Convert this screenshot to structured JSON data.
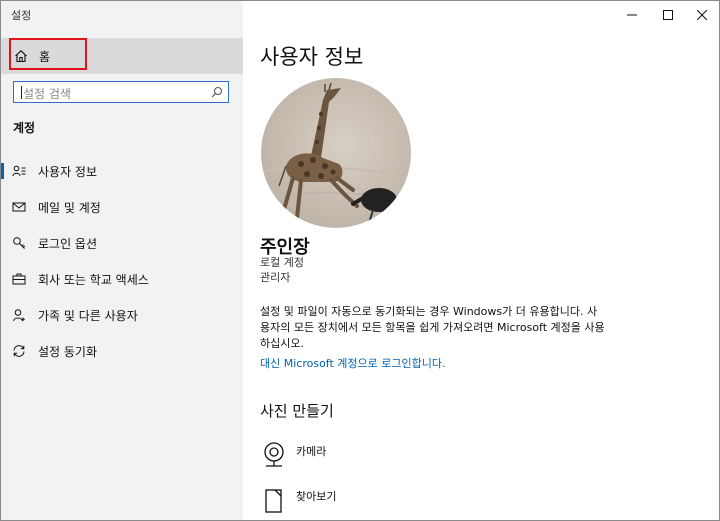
{
  "window": {
    "title": "설정"
  },
  "sidebar": {
    "home_label": "홈",
    "search_placeholder": "설정 검색",
    "section_label": "계정",
    "items": [
      {
        "label": "사용자 정보",
        "icon": "user-info-icon"
      },
      {
        "label": "메일 및 계정",
        "icon": "mail-icon"
      },
      {
        "label": "로그인 옵션",
        "icon": "key-icon"
      },
      {
        "label": "회사 또는 학교 액세스",
        "icon": "briefcase-icon"
      },
      {
        "label": "가족 및 다른 사용자",
        "icon": "person-add-icon"
      },
      {
        "label": "설정 동기화",
        "icon": "sync-icon"
      }
    ]
  },
  "main": {
    "title": "사용자 정보",
    "user_name": "주인장",
    "account_type": "로컬 계정",
    "role": "관리자",
    "description": "설정 및 파일이 자동으로 동기화되는 경우 Windows가 더 유용합니다. 사용자의 모든 장치에서 모든 항목을 쉽게 가져오려면 Microsoft 계정을 사용하십시오.",
    "link": "대신 Microsoft 계정으로 로그인합니다.",
    "photo_section_title": "사진 만들기",
    "photo_options": [
      {
        "label": "카메라",
        "icon": "camera-icon"
      },
      {
        "label": "찾아보기",
        "icon": "browse-icon"
      }
    ]
  },
  "colors": {
    "accent": "#0063b1",
    "highlight": "#e0141b",
    "sidebar_bg": "#f2f2f2"
  }
}
